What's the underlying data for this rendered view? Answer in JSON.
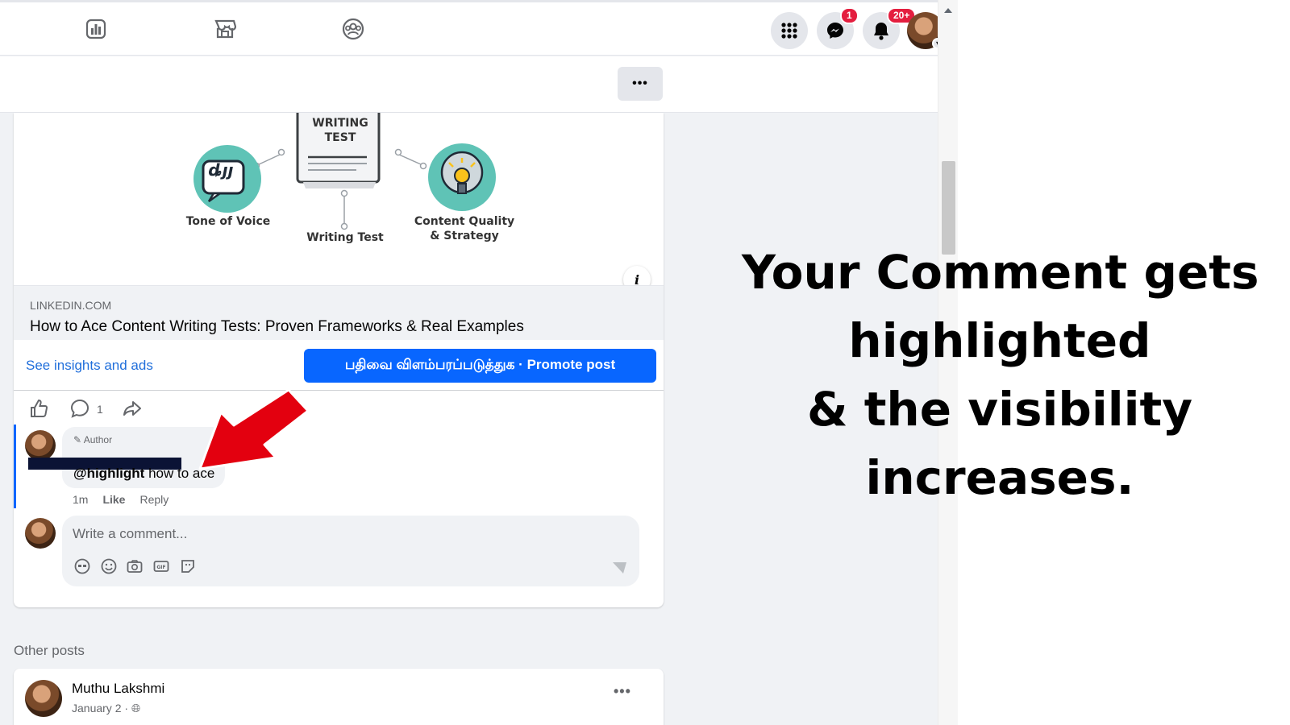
{
  "topnav": {
    "icons": [
      "chart-icon",
      "storefront-icon",
      "groups-icon",
      "menu-grid-icon",
      "messenger-icon",
      "notifications-icon"
    ],
    "messenger_badge": "1",
    "notifications_badge": "20+",
    "more_label": "•••"
  },
  "post": {
    "image": {
      "center_label_line1": "WRITING",
      "center_label_line2": "TEST",
      "left_caption": "Tone of Voice",
      "center_caption": "Writing Test",
      "right_caption_line1": "Content Quality",
      "right_caption_line2": "& Strategy",
      "bubble_text": "ȡȷȷ"
    },
    "link_domain": "LINKEDIN.COM",
    "link_title": "How to Ace Content Writing Tests: Proven Frameworks & Real Examples",
    "info_label": "i",
    "insights_label": "See insights and ads",
    "promote_label": "பதிவை விளம்பரப்படுத்துக · Promote post",
    "comment_count": "1"
  },
  "comment": {
    "author_tag": "Author",
    "mention": "@highlight",
    "text_rest": " how to ace",
    "more": "•••",
    "time": "1m",
    "like": "Like",
    "reply": "Reply"
  },
  "composer": {
    "placeholder": "Write a comment..."
  },
  "other_posts": {
    "heading": "Other posts",
    "author": "Muthu Lakshmi",
    "date": "January 2 · ",
    "more": "•••"
  },
  "callout": {
    "line1": "Your Comment gets",
    "line2": "highlighted",
    "line3": "& the visibility",
    "line4": "increases."
  },
  "colors": {
    "accent": "#0866ff",
    "badge": "#e41e3f",
    "arrow": "#e3000f",
    "link": "#216fdb"
  }
}
